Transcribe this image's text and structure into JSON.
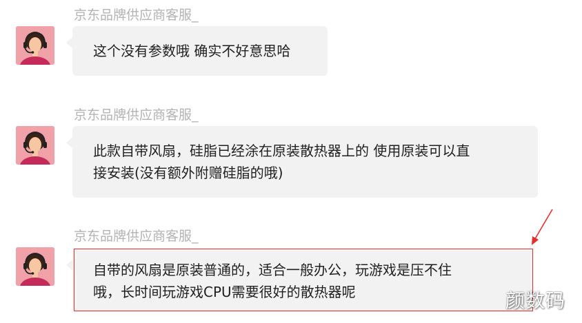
{
  "messages": [
    {
      "sender": "京东品牌供应商客服_",
      "avatar_icon": "customer-service-agent-headset",
      "lines": [
        "这个没有参数哦 确实不好意思哈"
      ]
    },
    {
      "sender": "京东品牌供应商客服_",
      "avatar_icon": "customer-service-agent-headset",
      "lines": [
        "此款自带风扇，硅脂已经涂在原装散热器上的 使用原装可以直",
        "接安装(没有额外附赠硅脂的哦)"
      ]
    },
    {
      "sender": "京东品牌供应商客服_",
      "avatar_icon": "customer-service-agent-headset",
      "lines": [
        "自带的风扇是原装普通的，适合一般办公，玩游戏是压不住",
        "哦，长时间玩游戏CPU需要很好的散热器呢"
      ],
      "highlighted": true
    }
  ],
  "annotation": {
    "color": "#e0302d"
  },
  "watermark": "颜数码",
  "colors": {
    "bubble": "#f2f2f2",
    "avatar_bg": "#f1a2a8",
    "sender": "#b3b3b3"
  }
}
